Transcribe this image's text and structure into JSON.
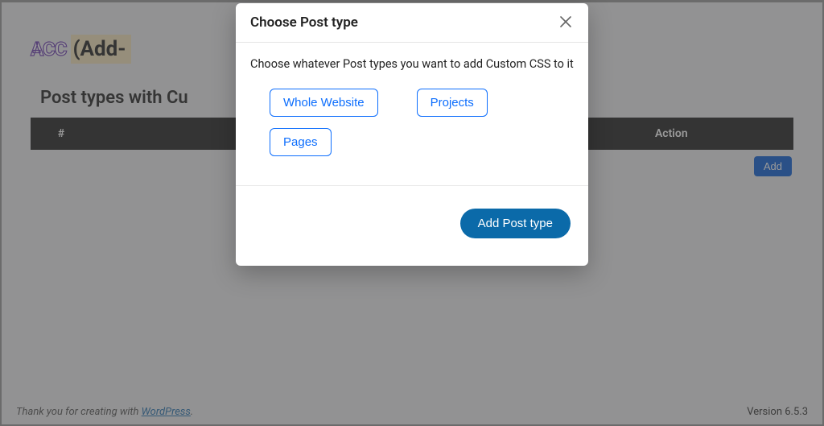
{
  "header": {
    "logo_text": "ACC",
    "title_suffix": "(Add-"
  },
  "section": {
    "title": "Post types with Cu"
  },
  "table": {
    "columns": {
      "number": "#",
      "action": "Action"
    }
  },
  "buttons": {
    "add": "Add"
  },
  "footer": {
    "thank_prefix": "Thank you for creating with ",
    "thank_link_text": "WordPress",
    "thank_suffix": ".",
    "version": "Version 6.5.3"
  },
  "modal": {
    "title": "Choose Post type",
    "description": "Choose whatever Post types you want to add Custom CSS to it",
    "options": [
      "Whole Website",
      "Projects",
      "Pages"
    ],
    "primary_button": "Add Post type"
  }
}
